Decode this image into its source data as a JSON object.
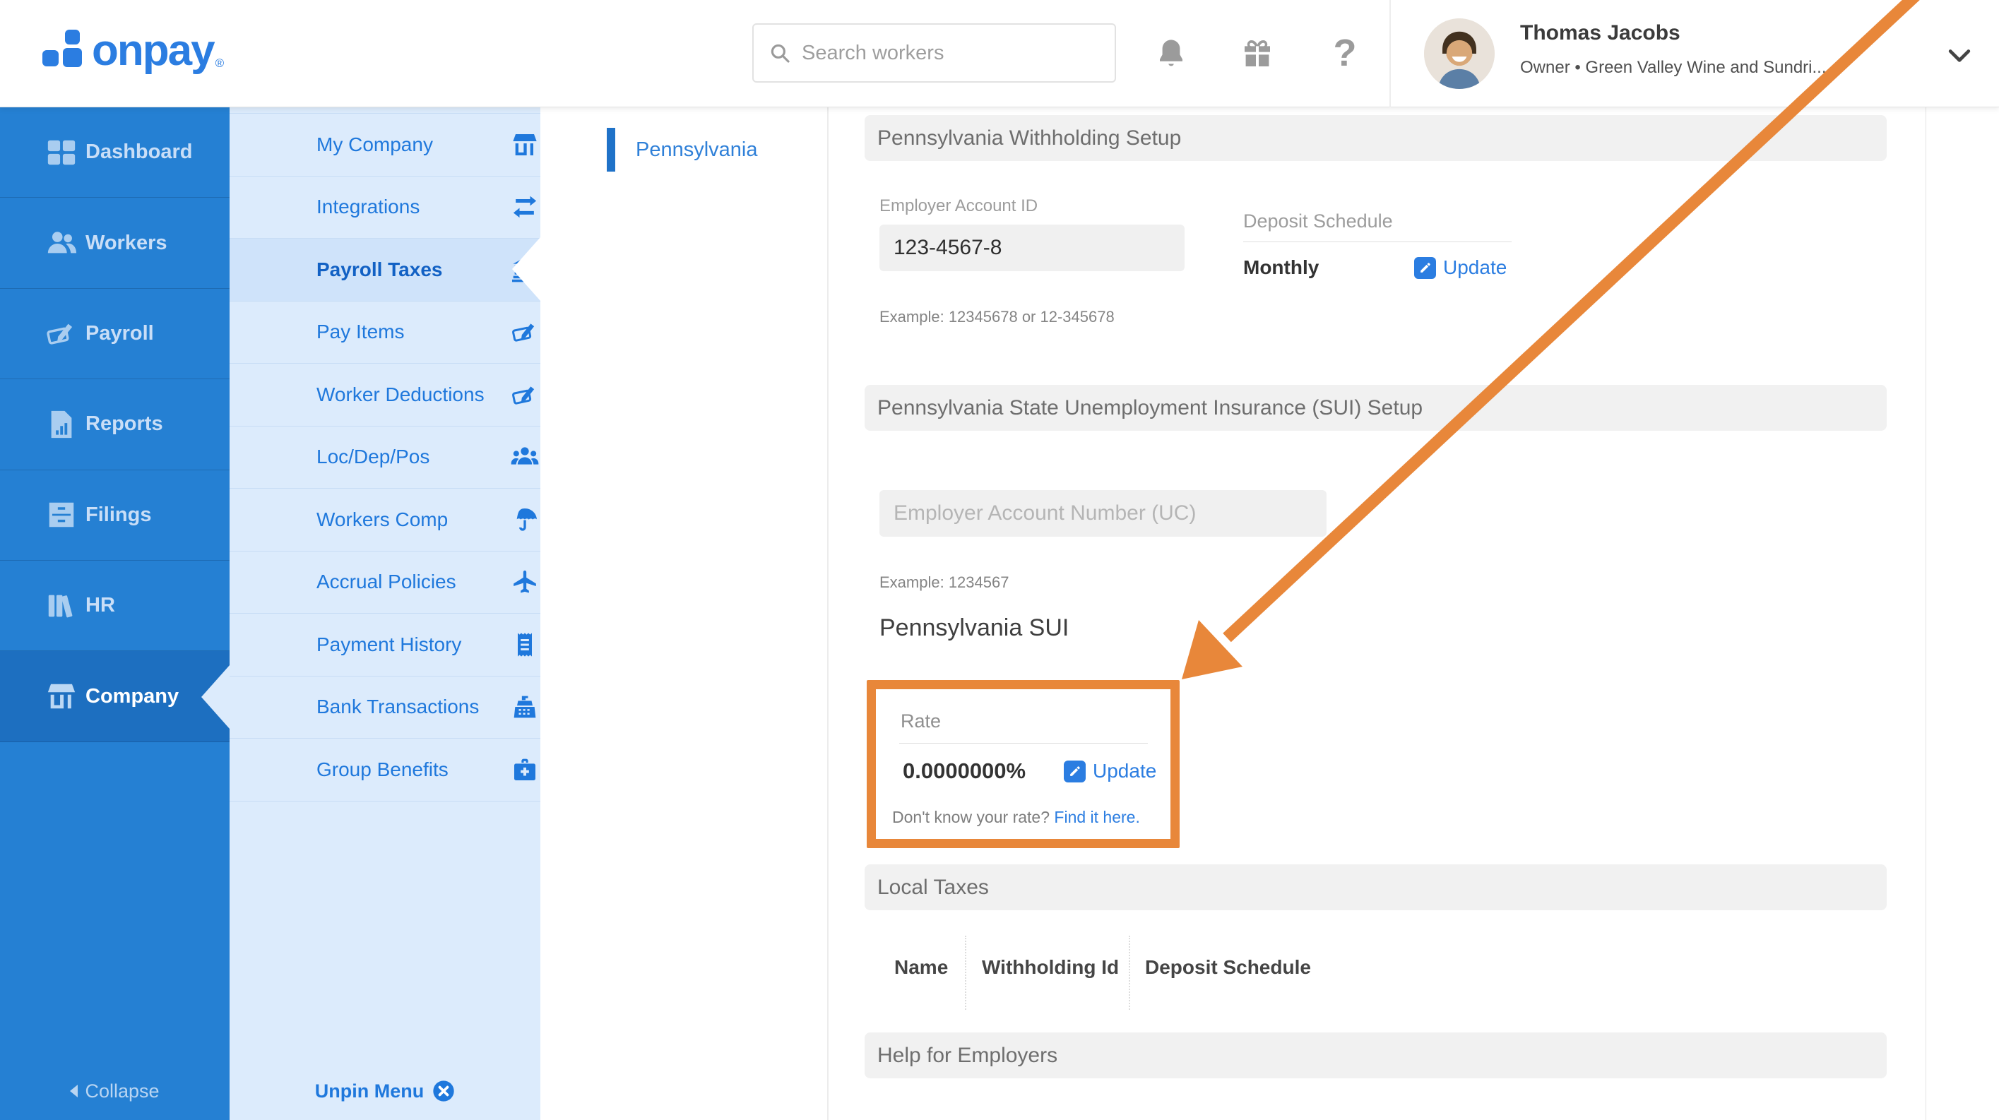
{
  "header": {
    "logo_text": "onpay",
    "logo_reg": "®",
    "search_placeholder": "Search workers",
    "user": {
      "name": "Thomas Jacobs",
      "subtitle": "Owner • Green Valley Wine and Sundri..."
    }
  },
  "sidebar": {
    "items": [
      {
        "label": "Dashboard",
        "icon": "dashboard-icon",
        "active": false
      },
      {
        "label": "Workers",
        "icon": "workers-icon",
        "active": false
      },
      {
        "label": "Payroll",
        "icon": "payroll-icon",
        "active": false
      },
      {
        "label": "Reports",
        "icon": "reports-icon",
        "active": false
      },
      {
        "label": "Filings",
        "icon": "filings-icon",
        "active": false
      },
      {
        "label": "HR",
        "icon": "hr-icon",
        "active": false
      },
      {
        "label": "Company",
        "icon": "storefront-icon",
        "active": true
      }
    ],
    "collapse_label": "Collapse"
  },
  "submenu": {
    "items": [
      {
        "label": "My Company",
        "icon": "storefront-icon",
        "active": false
      },
      {
        "label": "Integrations",
        "icon": "integrations-icon",
        "active": false
      },
      {
        "label": "Payroll Taxes",
        "icon": "bank-icon",
        "active": true
      },
      {
        "label": "Pay Items",
        "icon": "pen-icon",
        "active": false
      },
      {
        "label": "Worker Deductions",
        "icon": "pen-icon",
        "active": false
      },
      {
        "label": "Loc/Dep/Pos",
        "icon": "people-icon",
        "active": false
      },
      {
        "label": "Workers Comp",
        "icon": "umbrella-icon",
        "active": false
      },
      {
        "label": "Accrual Policies",
        "icon": "airplane-icon",
        "active": false
      },
      {
        "label": "Payment History",
        "icon": "receipt-icon",
        "active": false
      },
      {
        "label": "Bank Transactions",
        "icon": "register-icon",
        "active": false
      },
      {
        "label": "Group Benefits",
        "icon": "medkit-icon",
        "active": false
      }
    ],
    "unpin_label": "Unpin Menu"
  },
  "statenav": {
    "items": [
      {
        "label": "Pennsylvania",
        "active": true
      }
    ]
  },
  "main": {
    "withholding": {
      "section_title": "Pennsylvania Withholding Setup",
      "account_label": "Employer Account ID",
      "account_value": "123-4567-8",
      "account_example": "Example: 12345678 or 12-345678",
      "deposit_label": "Deposit Schedule",
      "deposit_value": "Monthly",
      "update_label": "Update"
    },
    "sui": {
      "section_title": "Pennsylvania State Unemployment Insurance (SUI) Setup",
      "account_placeholder": "Employer Account Number (UC)",
      "account_example": "Example: 1234567",
      "subheading": "Pennsylvania SUI",
      "rate_label": "Rate",
      "rate_value": "0.0000000%",
      "update_label": "Update",
      "rate_help_prefix": "Don't know your rate? ",
      "rate_help_link": "Find it here."
    },
    "local_taxes": {
      "section_title": "Local Taxes",
      "columns": [
        "Name",
        "Withholding Id",
        "Deposit Schedule"
      ]
    },
    "help": {
      "section_title": "Help for Employers"
    }
  },
  "colors": {
    "brand_blue": "#2580d3",
    "active_blue": "#1d6fc0",
    "submenu_blue": "#dcebfc",
    "link_blue": "#2b7de1",
    "accent_orange": "#e8873a"
  }
}
